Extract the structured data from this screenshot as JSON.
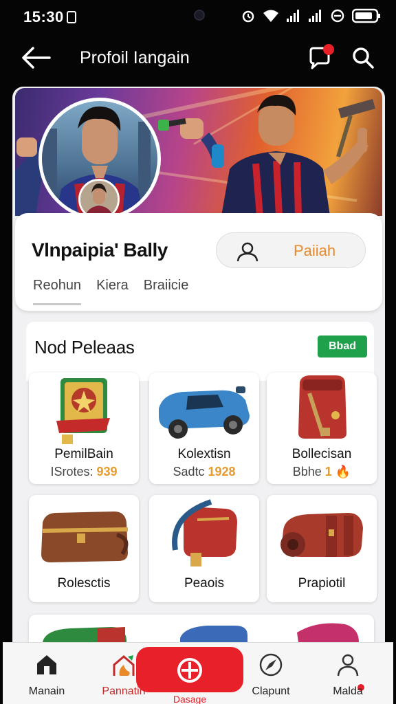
{
  "status_bar": {
    "time": "15:30"
  },
  "header": {
    "title": "Profoil Iangain",
    "back_icon": "arrow-left-icon",
    "notification_icon": "chat-bubble-icon",
    "search_icon": "search-icon"
  },
  "profile": {
    "name": "Vlnpaipia' Bally",
    "action_label": "Paiiah",
    "tabs": [
      "Reohun",
      "Kiera",
      "Braiicie"
    ],
    "active_tab": 0
  },
  "section": {
    "title": "Nod Peleaas",
    "badge": "Bbad"
  },
  "items": [
    {
      "name": "PemilBain",
      "sub_label": "ISrotes:",
      "sub_value": "939",
      "icon": "badge-medal-icon"
    },
    {
      "name": "Kolextisn",
      "sub_label": "Sadtc",
      "sub_value": "1928",
      "icon": "toy-car-icon"
    },
    {
      "name": "Bollecisan",
      "sub_label": "Bbhe",
      "sub_value": "1",
      "icon": "backpack-icon"
    },
    {
      "name": "Rolesctis",
      "sub_label": "",
      "sub_value": "",
      "icon": "suitcase-icon"
    },
    {
      "name": "Peaois",
      "sub_label": "",
      "sub_value": "",
      "icon": "bag-icon"
    },
    {
      "name": "Prapiotil",
      "sub_label": "",
      "sub_value": "",
      "icon": "bedroll-icon"
    }
  ],
  "bottom_nav": [
    {
      "label": "Manain",
      "icon": "home-icon"
    },
    {
      "label": "Pannatih",
      "icon": "flame-icon"
    },
    {
      "label": "Dasage",
      "icon": "plus-circle-icon"
    },
    {
      "label": "Clapunt",
      "icon": "compass-icon"
    },
    {
      "label": "Malda",
      "icon": "person-icon"
    }
  ],
  "colors": {
    "accent": "#e8202a",
    "orange": "#e8892a",
    "green_badge": "#1fa04a",
    "background": "#050505"
  }
}
